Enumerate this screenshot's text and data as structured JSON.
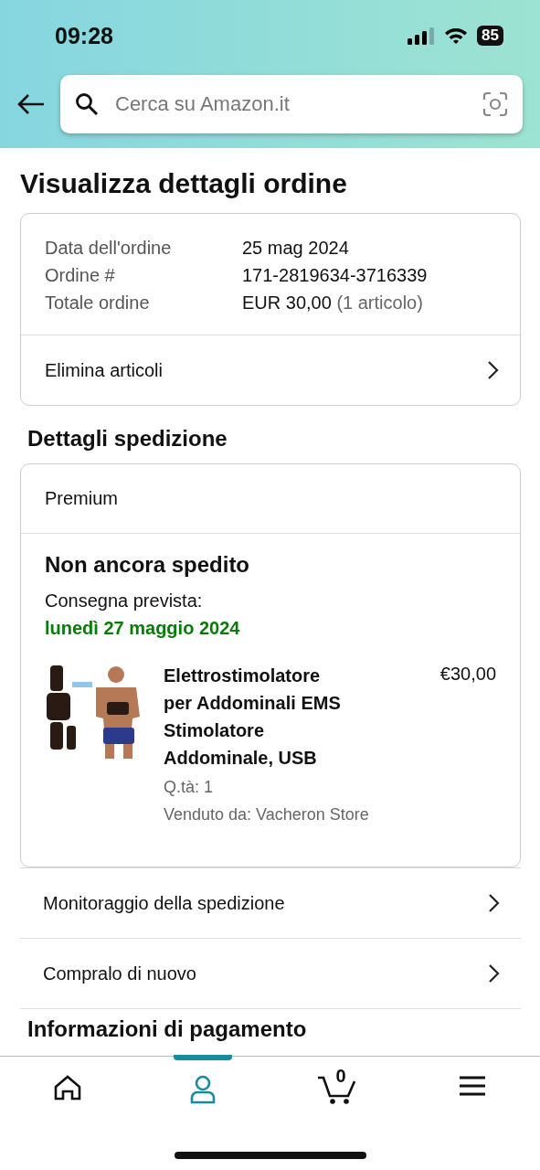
{
  "status_bar": {
    "time": "09:28",
    "battery": "85"
  },
  "search": {
    "placeholder": "Cerca su Amazon.it"
  },
  "title": "Visualizza dettagli ordine",
  "order_summary": {
    "rows": [
      {
        "label": "Data dell'ordine",
        "value": "25 mag 2024"
      },
      {
        "label": "Ordine #",
        "value": "171-2819634-3716339"
      },
      {
        "label": "Totale ordine",
        "value": "EUR 30,00",
        "note": "(1 articolo)"
      }
    ],
    "action": "Elimina articoli"
  },
  "shipping_heading": "Dettagli spedizione",
  "shipment": {
    "service": "Premium",
    "status": "Non ancora spedito",
    "delivery_label": "Consegna prevista:",
    "delivery_date": "lunedì 27 maggio 2024",
    "item": {
      "kind": "picture",
      "title": "Elettrostimolatore per Addominali EMS Stimolatore Addominale, USB",
      "price": "€30,00",
      "quantity": "Q.tà: 1",
      "seller": "Venduto da: Vacheron Store"
    }
  },
  "actions": [
    "Monitoraggio della spedizione",
    "Compralo di nuovo"
  ],
  "payment_heading": "Informazioni di pagamento",
  "bottom_nav": [
    {
      "kind": "home",
      "selected": false
    },
    {
      "kind": "account",
      "selected": true
    },
    {
      "kind": "cart",
      "selected": false,
      "count": "0"
    },
    {
      "kind": "menu",
      "selected": false
    }
  ]
}
